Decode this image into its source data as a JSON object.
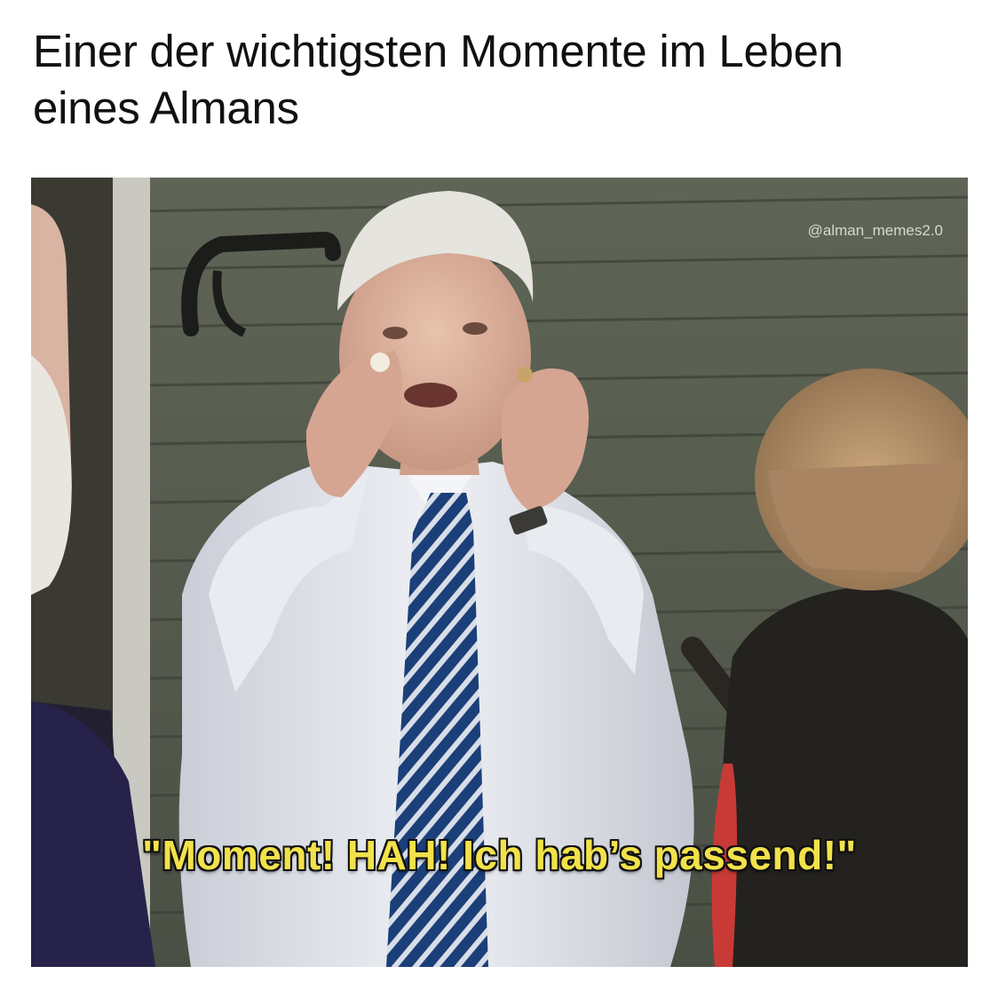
{
  "caption": {
    "line1": "Einer der wichtigsten Momente im Leben",
    "line2": "eines Almans"
  },
  "photo": {
    "watermark": "@alman_memes2.0",
    "subtitle": "\"Moment! HAH! Ich hab’s passend!\""
  },
  "colors": {
    "subtitle_fill": "#f2e24a",
    "siding": "#585e4f",
    "tie": "#1d4f8a"
  }
}
